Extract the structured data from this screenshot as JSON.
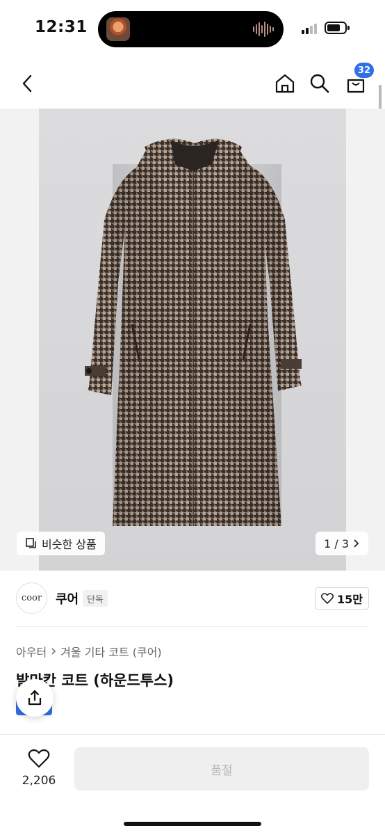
{
  "status": {
    "time": "12:31"
  },
  "nav": {
    "cart_count": "32",
    "icons": [
      "back-arrow-icon",
      "home-icon",
      "search-icon",
      "cart-icon"
    ]
  },
  "gallery": {
    "similar_label": "비슷한 상품",
    "page_indicator": "1 / 3",
    "current_page": 1,
    "total_pages": 3
  },
  "shop": {
    "logo_text": "coor",
    "name": "쿠어",
    "tag": "단독",
    "likes": "15만"
  },
  "breadcrumb": {
    "category": "아우터",
    "subcategory": "겨울 기타 코트 (쿠어)"
  },
  "product": {
    "title": "발마칸 코트 (하운드투스)"
  },
  "bottom": {
    "wish_count": "2,206",
    "soldout_label": "품절"
  },
  "colors": {
    "accent": "#2f6fe8",
    "coat_base": "#5a4a40",
    "soldout_bg": "#efefef"
  }
}
